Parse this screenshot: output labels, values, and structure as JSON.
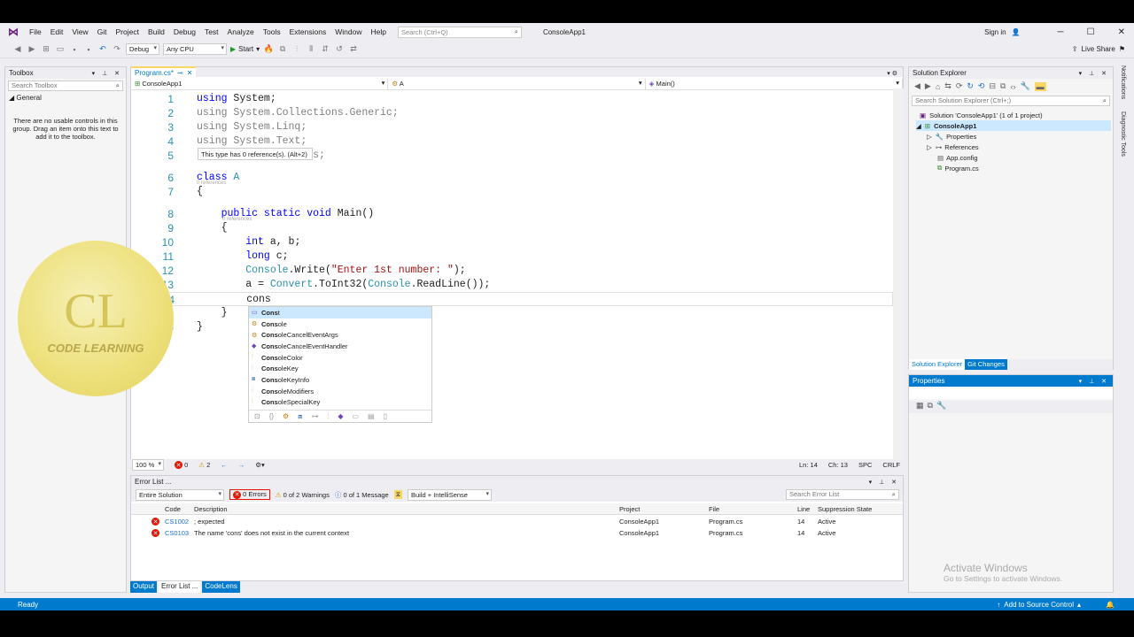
{
  "titlebar": {
    "menus": [
      "File",
      "Edit",
      "View",
      "Git",
      "Project",
      "Build",
      "Debug",
      "Test",
      "Analyze",
      "Tools",
      "Extensions",
      "Window",
      "Help"
    ],
    "search_placeholder": "Search (Ctrl+Q)",
    "project_name": "ConsoleApp1",
    "sign_in": "Sign in",
    "live_share": "Live Share"
  },
  "toolbar": {
    "config": "Debug",
    "platform": "Any CPU",
    "start": "Start"
  },
  "toolbox": {
    "title": "Toolbox",
    "search_placeholder": "Search Toolbox",
    "group": "General",
    "empty_message": "There are no usable controls in this group. Drag an item onto this text to add it to the toolbox."
  },
  "editor": {
    "tab_label": "Program.cs*",
    "nav_project": "ConsoleApp1",
    "nav_class": "A",
    "nav_member": "Main()",
    "tooltip": "This type has 0 reference(s). (Alt+2)",
    "ref_class": "0 references",
    "ref_method": "0 references",
    "lines": [
      {
        "n": "1",
        "segs": [
          {
            "t": "using",
            "c": "kw"
          },
          {
            "t": " System;",
            "c": ""
          }
        ]
      },
      {
        "n": "2",
        "segs": [
          {
            "t": "using System.Collections.Generic;",
            "c": "dim"
          }
        ]
      },
      {
        "n": "3",
        "segs": [
          {
            "t": "using System.Linq;",
            "c": "dim"
          }
        ]
      },
      {
        "n": "4",
        "segs": [
          {
            "t": "using System.Text;",
            "c": "dim"
          }
        ]
      },
      {
        "n": "5",
        "segs": [
          {
            "t": "          ding.Tasks;",
            "c": "dim"
          }
        ]
      },
      {
        "n": "6",
        "segs": [
          {
            "t": "class",
            "c": "kw"
          },
          {
            "t": " ",
            "c": ""
          },
          {
            "t": "A",
            "c": "ty"
          }
        ]
      },
      {
        "n": "7",
        "segs": [
          {
            "t": "{",
            "c": ""
          }
        ]
      },
      {
        "n": "8",
        "segs": [
          {
            "t": "    ",
            "c": ""
          },
          {
            "t": "public static void",
            "c": "kw"
          },
          {
            "t": " Main()",
            "c": ""
          }
        ]
      },
      {
        "n": "9",
        "segs": [
          {
            "t": "    {",
            "c": ""
          }
        ]
      },
      {
        "n": "10",
        "segs": [
          {
            "t": "        ",
            "c": ""
          },
          {
            "t": "int",
            "c": "kw"
          },
          {
            "t": " a, b;",
            "c": ""
          }
        ]
      },
      {
        "n": "11",
        "segs": [
          {
            "t": "        ",
            "c": ""
          },
          {
            "t": "long",
            "c": "kw"
          },
          {
            "t": " c;",
            "c": ""
          }
        ]
      },
      {
        "n": "12",
        "segs": [
          {
            "t": "        ",
            "c": ""
          },
          {
            "t": "Console",
            "c": "ty"
          },
          {
            "t": ".Write(",
            "c": ""
          },
          {
            "t": "\"Enter 1st number: \"",
            "c": "st"
          },
          {
            "t": ");",
            "c": ""
          }
        ]
      },
      {
        "n": "13",
        "segs": [
          {
            "t": "        a = ",
            "c": ""
          },
          {
            "t": "Convert",
            "c": "ty"
          },
          {
            "t": ".ToInt32(",
            "c": ""
          },
          {
            "t": "Console",
            "c": "ty"
          },
          {
            "t": ".ReadLine());",
            "c": ""
          }
        ]
      },
      {
        "n": "14",
        "segs": [
          {
            "t": "        cons",
            "c": ""
          }
        ]
      },
      {
        "n": "15",
        "segs": [
          {
            "t": "    }",
            "c": ""
          }
        ]
      },
      {
        "n": "16",
        "segs": [
          {
            "t": "}",
            "c": ""
          }
        ]
      }
    ],
    "intellisense": [
      {
        "bold": "Cons",
        "rest": "t",
        "label": "const",
        "icon": "keyword-icon"
      },
      {
        "bold": "Cons",
        "rest": "ole",
        "label": "Console",
        "icon": "class-icon"
      },
      {
        "bold": "Cons",
        "rest": "oleCancelEventArgs",
        "label": "ConsoleCancelEventArgs",
        "icon": "class-icon"
      },
      {
        "bold": "Cons",
        "rest": "oleCancelEventHandler",
        "label": "ConsoleCancelEventHandler",
        "icon": "delegate-icon"
      },
      {
        "bold": "Cons",
        "rest": "oleColor",
        "label": "ConsoleColor",
        "icon": "enum-icon"
      },
      {
        "bold": "Cons",
        "rest": "oleKey",
        "label": "ConsoleKey",
        "icon": "enum-icon"
      },
      {
        "bold": "Cons",
        "rest": "oleKeyInfo",
        "label": "ConsoleKeyInfo",
        "icon": "struct-icon"
      },
      {
        "bold": "Cons",
        "rest": "oleModifiers",
        "label": "ConsoleModifiers",
        "icon": "enum-icon"
      },
      {
        "bold": "Cons",
        "rest": "oleSpecialKey",
        "label": "ConsoleSpecialKey",
        "icon": "enum-icon"
      }
    ],
    "status": {
      "zoom": "100 %",
      "errors": "0",
      "warnings": "2",
      "ln": "Ln: 14",
      "ch": "Ch: 13",
      "enc": "SPC",
      "eol": "CRLF"
    }
  },
  "solution_explorer": {
    "title": "Solution Explorer",
    "search_placeholder": "Search Solution Explorer (Ctrl+;)",
    "solution": "Solution 'ConsoleApp1' (1 of 1 project)",
    "project": "ConsoleApp1",
    "items": [
      "Properties",
      "References",
      "App.config",
      "Program.cs"
    ],
    "tab1": "Solution Explorer",
    "tab2": "Git Changes"
  },
  "properties": {
    "title": "Properties"
  },
  "error_list": {
    "title": "Error List ...",
    "scope": "Entire Solution",
    "errors_btn": "0 Errors",
    "warnings_btn": "0 of 2 Warnings",
    "messages_btn": "0 of 1 Message",
    "build_filter": "Build + IntelliSense",
    "search_placeholder": "Search Error List",
    "columns": [
      "Code",
      "Description",
      "Project",
      "File",
      "Line",
      "Suppression State"
    ],
    "rows": [
      {
        "code": "CS1002",
        "desc": "; expected",
        "project": "ConsoleApp1",
        "file": "Program.cs",
        "line": "14",
        "state": "Active"
      },
      {
        "code": "CS0103",
        "desc": "The name 'cons' does not exist in the current context",
        "project": "ConsoleApp1",
        "file": "Program.cs",
        "line": "14",
        "state": "Active"
      }
    ]
  },
  "bottom_tabs": [
    "Output",
    "Error List ...",
    "CodeLens"
  ],
  "statusbar": {
    "ready": "Ready",
    "source_control": "Add to Source Control"
  },
  "right_rail": [
    "Notifications",
    "Diagnostic Tools"
  ],
  "watermark": {
    "line1": "Activate Windows",
    "line2": "Go to Settings to activate Windows."
  },
  "logo": {
    "text": "CODE LEARNING",
    "mono": "CL"
  },
  "colors": {
    "accent": "#007acc",
    "keyword": "#0000ff",
    "type": "#2b91af",
    "string": "#a31515",
    "error": "#e51400"
  }
}
